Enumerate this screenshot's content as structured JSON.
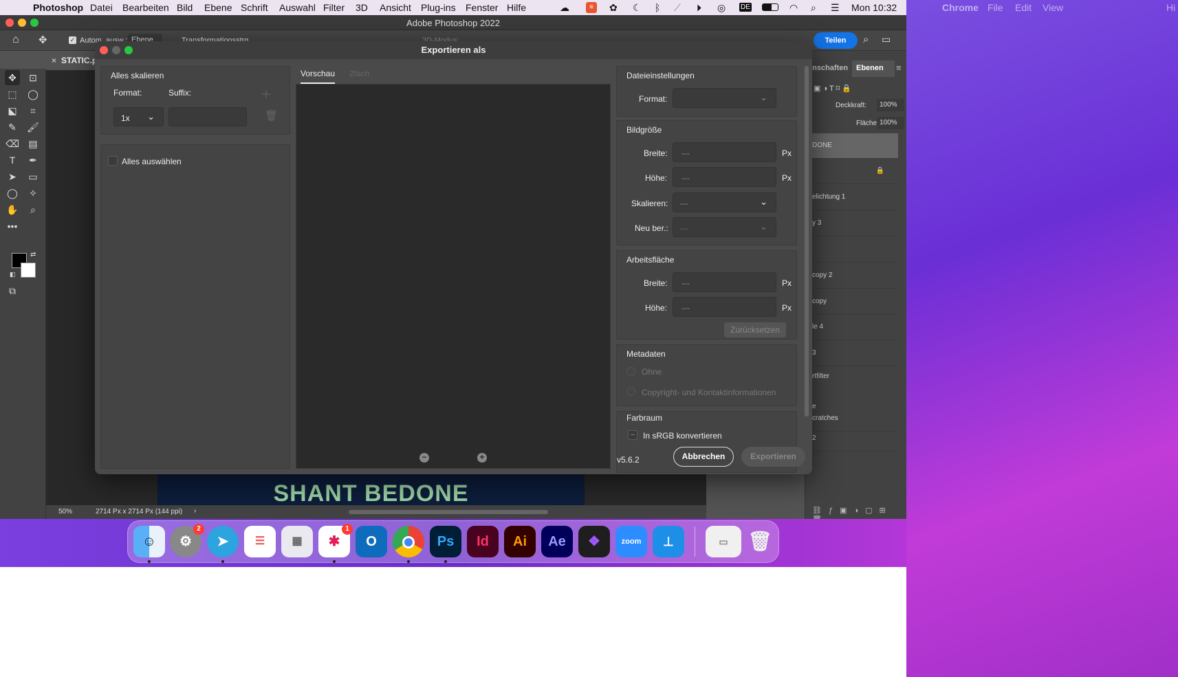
{
  "menubar": {
    "app_name": "Photoshop",
    "items": [
      "Datei",
      "Bearbeiten",
      "Bild",
      "Ebene",
      "Schrift",
      "Auswahl",
      "Filter",
      "3D",
      "Ansicht",
      "Plug-ins",
      "Fenster",
      "Hilfe"
    ],
    "clock": "Mon 10:32",
    "input_source": "DE"
  },
  "chrome_menubar": {
    "app_name": "Chrome",
    "items": [
      "File",
      "Edit",
      "View",
      "Hi"
    ]
  },
  "window": {
    "title": "Adobe Photoshop 2022"
  },
  "options_bar": {
    "auto_select": "Autom. ausw.:",
    "auto_select_value": "Ebene",
    "transform": "Transformationsstrg.",
    "mode_3d": "3D-Modus:",
    "share": "Teilen"
  },
  "document": {
    "tab": "STATIC.p",
    "zoom": "50%",
    "info": "2714 Px x 2714 Px (144 ppi)",
    "canvas_text": "SHANT BEDONE"
  },
  "panels": {
    "tab_properties": "enschaften",
    "tab_layers": "Ebenen",
    "opacity_label": "Deckkraft:",
    "opacity_value": "100%",
    "fill_label": "Fläche:",
    "fill_value": "100%",
    "layers": [
      "DONE",
      "",
      "elichtung 1",
      "y 3",
      "",
      "copy 2",
      "copy",
      "le 4",
      "3",
      "rtfilter",
      "e",
      "cratches",
      "2"
    ]
  },
  "dialog": {
    "title": "Exportieren als",
    "scale_all": "Alles skalieren",
    "format_label": "Format:",
    "suffix_label": "Suffix:",
    "scale_value": "1x",
    "suffix_value": "",
    "select_all": "Alles auswählen",
    "tab_preview": "Vorschau",
    "tab_2x": "2fach",
    "file_settings": "Dateieinstellungen",
    "file_format_label": "Format:",
    "image_size": "Bildgröße",
    "width_label": "Breite:",
    "height_label": "Höhe:",
    "scale_label": "Skalieren:",
    "resample_label": "Neu ber.:",
    "placeholder": "---",
    "unit": "Px",
    "artboard": "Arbeitsfläche",
    "reset": "Zurücksetzen",
    "metadata": "Metadaten",
    "meta_none": "Ohne",
    "meta_copyright": "Copyright- und Kontaktinformationen",
    "colorspace": "Farbraum",
    "srgb": "In sRGB konvertieren",
    "version": "v5.6.2",
    "cancel": "Abbrechen",
    "export": "Exportieren"
  },
  "dock": {
    "badges": {
      "settings": "2",
      "slack": "1"
    },
    "labels": {
      "photoshop": "Ps",
      "indesign": "Id",
      "illustrator": "Ai",
      "aftereffects": "Ae",
      "zoom": "zoom"
    }
  }
}
